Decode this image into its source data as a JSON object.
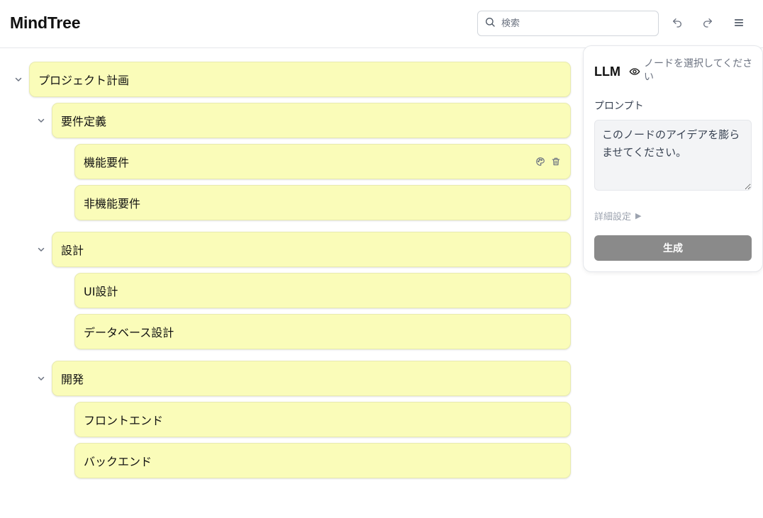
{
  "app": {
    "title": "MindTree"
  },
  "search": {
    "placeholder": "検索",
    "value": ""
  },
  "toolbar": {
    "undo_icon": "undo-icon",
    "redo_icon": "redo-icon",
    "menu_icon": "hamburger-menu-icon"
  },
  "colors": {
    "node_bg": "#fafcb9",
    "generate_button_bg": "#8a8a8a"
  },
  "tree": {
    "nodes": [
      {
        "label": "プロジェクト計画",
        "level": 0,
        "collapsible": true,
        "expanded": true
      },
      {
        "label": "要件定義",
        "level": 1,
        "collapsible": true,
        "expanded": true
      },
      {
        "label": "機能要件",
        "level": 2,
        "collapsible": false,
        "hovered": true,
        "actions": [
          "palette-icon",
          "trash-icon"
        ]
      },
      {
        "label": "非機能要件",
        "level": 2,
        "collapsible": false
      },
      {
        "label": "設計",
        "level": 1,
        "collapsible": true,
        "expanded": true
      },
      {
        "label": "UI設計",
        "level": 2,
        "collapsible": false
      },
      {
        "label": "データベース設計",
        "level": 2,
        "collapsible": false
      },
      {
        "label": "開発",
        "level": 1,
        "collapsible": true,
        "expanded": true
      },
      {
        "label": "フロントエンド",
        "level": 2,
        "collapsible": false
      },
      {
        "label": "バックエンド",
        "level": 2,
        "collapsible": false
      }
    ]
  },
  "llm_panel": {
    "title": "LLM",
    "status_icon": "eye-icon",
    "hint": "ノードを選択してください",
    "prompt_label": "プロンプト",
    "prompt_value": "このノードのアイデアを膨らませてください。",
    "advanced_label": "詳細設定",
    "advanced_indicator": "▶",
    "generate_label": "生成"
  }
}
